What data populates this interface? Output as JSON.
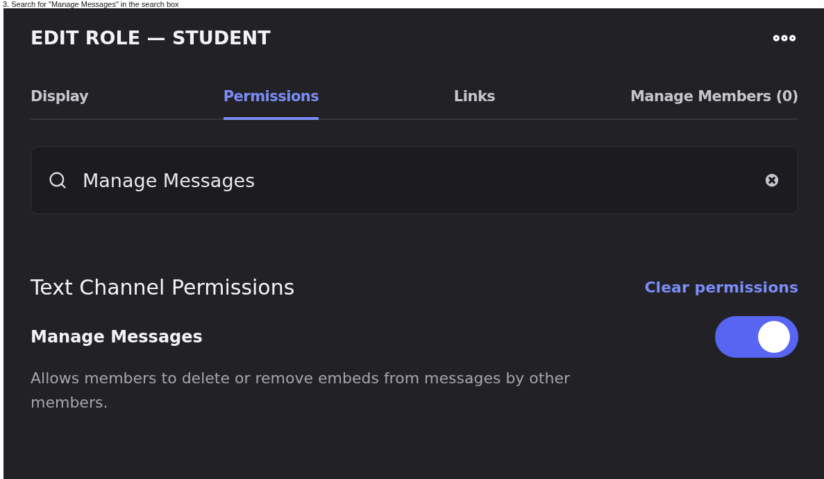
{
  "caption": "3. Search for \"Manage Messages\" in the search box",
  "header": {
    "title": "EDIT ROLE — STUDENT"
  },
  "tabs": [
    {
      "label": "Display",
      "selected": false
    },
    {
      "label": "Permissions",
      "selected": true
    },
    {
      "label": "Links",
      "selected": false
    },
    {
      "label": "Manage Members (0)",
      "selected": false
    }
  ],
  "search": {
    "value": "Manage Messages"
  },
  "section": {
    "title": "Text Channel Permissions",
    "action": "Clear permissions"
  },
  "permissions": [
    {
      "name": "Manage Messages",
      "description": "Allows members to delete or remove embeds from messages by other members.",
      "on": true
    }
  ]
}
